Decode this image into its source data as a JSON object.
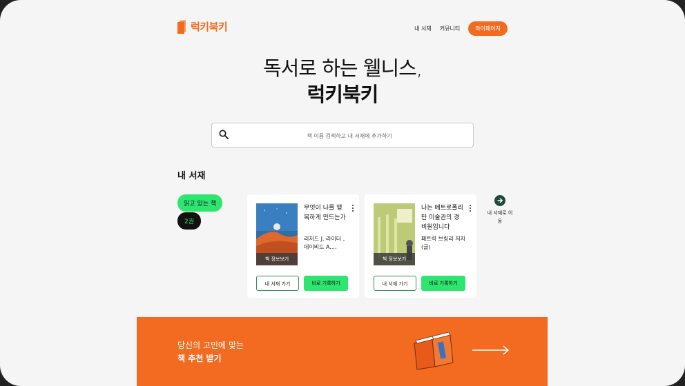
{
  "header": {
    "logo_text": "럭키북키",
    "nav": [
      "내 서재",
      "커뮤니티"
    ],
    "mypage_label": "마이페이지"
  },
  "hero": {
    "line1": "독서로 하는 웰니스,",
    "line2": "럭키북키"
  },
  "search": {
    "placeholder": "책 이름 검색하고 내 서재에 추가하기"
  },
  "shelf": {
    "title": "내 서재",
    "reading_label": "읽고 있는 책",
    "count_label": "2권",
    "cover_info_label": "책 정보보기",
    "shelf_button": "내 서재 가기",
    "record_button": "바로 기록하기",
    "books": [
      {
        "title": "무엇이 나를 행복하게 만드는가",
        "author": "리처드 J. 라이더 , 데이비드 A...."
      },
      {
        "title": "나는 메트로폴리탄 미술관의 경비원입니다",
        "author": "패트릭 브링리 저자(글)"
      }
    ],
    "goto_label": "내 서재로 이동"
  },
  "banner": {
    "line1": "당신의 고민에 맞는",
    "line2": "책 추천 받기"
  },
  "colors": {
    "brand_orange": "#f26b21",
    "accent_green": "#2ee56f",
    "dark_green": "#1e4a3a"
  }
}
